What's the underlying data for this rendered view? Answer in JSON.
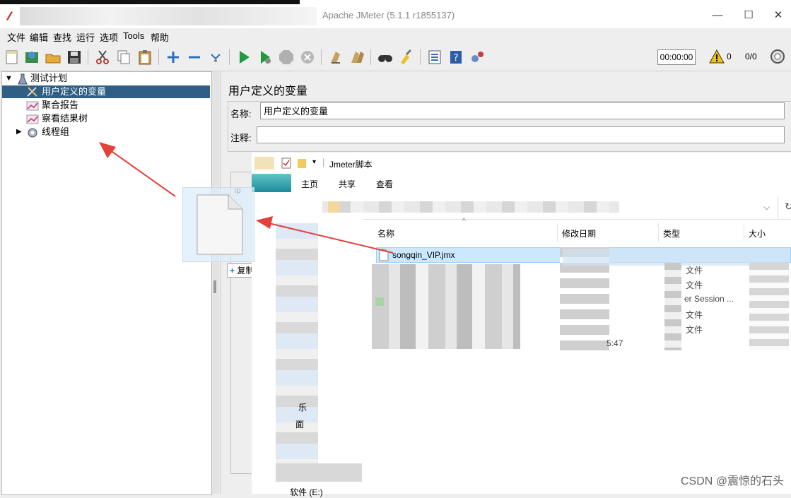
{
  "window": {
    "title": "Apache JMeter (5.1.1 r1855137)",
    "controls": [
      "—",
      "☐",
      "✕"
    ]
  },
  "menu": [
    "文件",
    "编辑",
    "查找",
    "运行",
    "选项",
    "Tools",
    "帮助"
  ],
  "toolbar": {
    "timer": "00:00:00",
    "warnings": "0",
    "threads": "0/0"
  },
  "tree": {
    "root": "测试计划",
    "items": [
      {
        "label": "用户定义的变量",
        "selected": true,
        "icon": "wrench-icon"
      },
      {
        "label": "聚合报告",
        "icon": "graph-icon"
      },
      {
        "label": "察看结果树",
        "icon": "graph-icon"
      },
      {
        "label": "线程组",
        "icon": "gear-icon"
      }
    ]
  },
  "panel": {
    "title": "用户定义的变量",
    "name_label": "名称:",
    "name_value": "用户定义的变量",
    "comment_label": "注释:",
    "comment_value": "",
    "tab_fragment": "ip",
    "add_button": "复制"
  },
  "explorer": {
    "path_title": "Jmeter脚本",
    "tabs": [
      "主页",
      "共享",
      "查看"
    ],
    "columns": [
      "名称",
      "修改日期",
      "类型",
      "大小"
    ],
    "file_selected": "songqin_VIP.jmx",
    "partial_cells": [
      "文件",
      "文件",
      "er Session ...",
      "文件",
      "文件",
      "5:47"
    ],
    "sidebar_fragments": [
      "乐",
      "面",
      "软件 (E:)"
    ]
  },
  "watermark": "CSDN @震惊的石头",
  "colors": {
    "selection": "#2f5f85",
    "arrow": "#e5403a",
    "explorer_select": "#cce8ff"
  }
}
